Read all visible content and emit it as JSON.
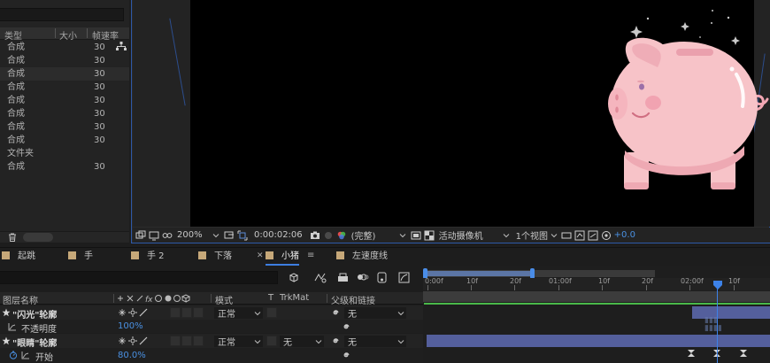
{
  "project_panel": {
    "columns": {
      "type": "类型",
      "size": "大小",
      "fps": "帧速率"
    },
    "rows": [
      {
        "type": "合成",
        "fps": "30"
      },
      {
        "type": "合成",
        "fps": "30"
      },
      {
        "type": "合成",
        "fps": "30"
      },
      {
        "type": "合成",
        "fps": "30"
      },
      {
        "type": "合成",
        "fps": "30"
      },
      {
        "type": "合成",
        "fps": "30"
      },
      {
        "type": "合成",
        "fps": "30"
      },
      {
        "type": "合成",
        "fps": "30"
      },
      {
        "type": "文件夹",
        "fps": ""
      },
      {
        "type": "合成",
        "fps": "30"
      }
    ]
  },
  "viewer_toolbar": {
    "zoom": "200%",
    "timecode": "0:00:02:06",
    "resolution": "(完整)",
    "camera": "活动摄像机",
    "views": "1个视图",
    "exposure": "+0.0"
  },
  "comp_tabs": [
    {
      "label": "起跳",
      "active": false
    },
    {
      "label": "手",
      "active": false
    },
    {
      "label": "手 2",
      "active": false
    },
    {
      "label": "下落",
      "active": false
    },
    {
      "label": "小猪",
      "active": true
    },
    {
      "label": "左速度线",
      "active": false
    }
  ],
  "layer_header": {
    "name": "图层名称",
    "mode": "模式",
    "t": "T",
    "trkmat": "TrkMat",
    "parent": "父级和链接"
  },
  "layers": [
    {
      "name": "\"闪光\"轮廓",
      "mode": "正常",
      "trkmat": "",
      "parent": "无"
    },
    {
      "name": "\"眼睛\"轮廓",
      "mode": "正常",
      "trkmat": "无",
      "parent": "无"
    }
  ],
  "properties": [
    {
      "name": "不透明度",
      "value": "100%"
    },
    {
      "name": "开始",
      "value": "80.0%"
    }
  ],
  "ruler_ticks": [
    "0:00f",
    "10f",
    "20f",
    "01:00f",
    "10f",
    "20f",
    "02:00f",
    "10f"
  ],
  "colors": {
    "accent_blue": "#3d82e8",
    "layer_bar": "#545f9c",
    "label_tan": "#c6a879",
    "pig_pink": "#f7c3c8"
  },
  "icons": [
    "star-icon",
    "stopwatch-icon",
    "graph-icon",
    "spiral-icon",
    "trash-icon",
    "camera-icon",
    "caret-down-icon"
  ]
}
